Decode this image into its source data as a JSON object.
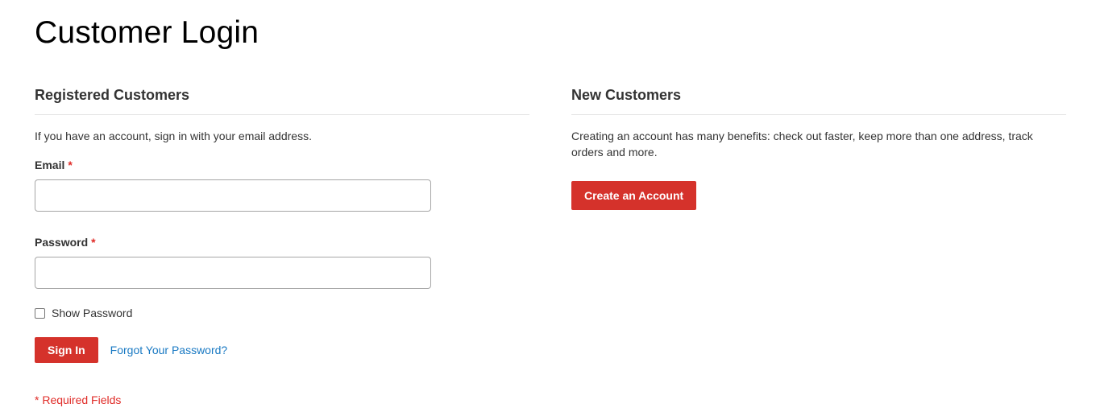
{
  "page": {
    "title": "Customer Login"
  },
  "registered": {
    "title": "Registered Customers",
    "intro": "If you have an account, sign in with your email address.",
    "email_label": "Email",
    "email_value": "",
    "password_label": "Password",
    "password_value": "",
    "required_marker": "*",
    "show_password_label": "Show Password",
    "show_password_checked": false,
    "sign_in_label": "Sign In",
    "forgot_password_label": "Forgot Your Password?",
    "required_note": "* Required Fields"
  },
  "new_customers": {
    "title": "New Customers",
    "intro": "Creating an account has many benefits: check out faster, keep more than one address, track orders and more.",
    "create_account_label": "Create an Account"
  },
  "colors": {
    "primary_button": "#d5322b",
    "link": "#1979c3",
    "required": "#e02b27"
  }
}
